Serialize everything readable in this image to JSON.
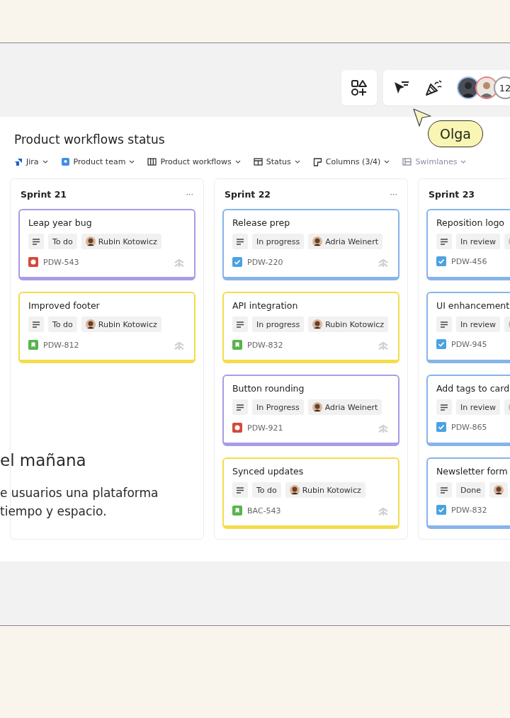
{
  "toolbar": {
    "avatar_count": "12"
  },
  "cursor": {
    "name": "Olga"
  },
  "board": {
    "title": "Product workflows status",
    "filters": [
      {
        "label": "Jira",
        "kind": "jira",
        "disabled": false
      },
      {
        "label": "Product team",
        "kind": "team",
        "disabled": false
      },
      {
        "label": "Product workflows",
        "kind": "board",
        "disabled": false
      },
      {
        "label": "Status",
        "kind": "status",
        "disabled": false
      },
      {
        "label": "Columns (3/4)",
        "kind": "columns",
        "disabled": false
      },
      {
        "label": "Swimlanes",
        "kind": "swimlanes",
        "disabled": true
      }
    ],
    "columns": [
      {
        "title": "Sprint 21",
        "menu": "···",
        "cards": [
          {
            "title": "Leap year bug",
            "status": "To do",
            "assignee": "Rubin Kotowicz",
            "kind": "bug",
            "key": "PDW-543",
            "color": "#a99ce8"
          },
          {
            "title": "Improved footer",
            "status": "To do",
            "assignee": "Rubin Kotowicz",
            "kind": "story",
            "key": "PDW-812",
            "color": "#f4dc4c"
          }
        ]
      },
      {
        "title": "Sprint 22",
        "menu": "···",
        "cards": [
          {
            "title": "Release prep",
            "status": "In progress",
            "assignee": "Adria Weinert",
            "kind": "task",
            "key": "PDW-220",
            "color": "#86b4ea"
          },
          {
            "title": "API integration",
            "status": "In progress",
            "assignee": "Rubin Kotowicz",
            "kind": "story",
            "key": "PDW-832",
            "color": "#f4dc4c"
          },
          {
            "title": "Button rounding",
            "status": "In Progress",
            "assignee": "Adria Weinert",
            "kind": "bug",
            "key": "PDW-921",
            "color": "#a99ce8"
          },
          {
            "title": "Synced updates",
            "status": "To do",
            "assignee": "Rubin Kotowicz",
            "kind": "story",
            "key": "BAC-543",
            "color": "#f4dc4c"
          }
        ]
      },
      {
        "title": "Sprint 23",
        "cards": [
          {
            "title": "Reposition logo",
            "status": "In review",
            "kind": "task",
            "key": "PDW-456",
            "color": "#86b4ea"
          },
          {
            "title": "UI enhancement",
            "status": "In review",
            "kind": "task",
            "key": "PDW-945",
            "color": "#86b4ea"
          },
          {
            "title": "Add tags to card",
            "status": "In review",
            "kind": "task",
            "key": "PDW-865",
            "color": "#86b4ea"
          },
          {
            "title": "Newsletter form",
            "status": "Done",
            "kind": "task",
            "key": "PDW-832",
            "color": "#86b4ea"
          }
        ]
      }
    ]
  },
  "overlay_text": {
    "heading": "el mañana",
    "lines": [
      "e usuarios una plataforma",
      "tiempo y espacio."
    ]
  }
}
